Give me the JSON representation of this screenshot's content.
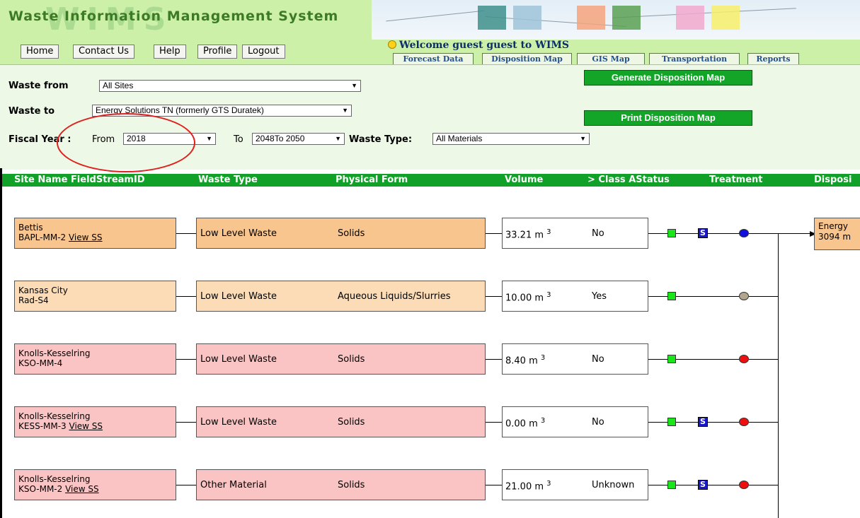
{
  "header": {
    "title": "Waste Information Management System",
    "watermark": "WIMS",
    "welcome": "Welcome guest guest to WIMS"
  },
  "nav": [
    "Home",
    "Contact Us",
    "Help",
    "Profile",
    "Logout"
  ],
  "tabs": [
    "Forecast Data",
    "Disposition Map",
    "GIS Map",
    "Transportation",
    "Reports"
  ],
  "filters": {
    "waste_from_label": "Waste from",
    "waste_from_value": "All Sites",
    "waste_to_label": "Waste to",
    "waste_to_value": "Energy Solutions TN (formerly GTS Duratek)",
    "fiscal_year_label": "Fiscal Year :",
    "from_label": "From",
    "from_value": "2018",
    "to_label": "To",
    "to_value": "2048To 2050",
    "waste_type_label": "Waste Type:",
    "waste_type_value": "All Materials",
    "generate_button": "Generate Disposition Map",
    "print_button": "Print Disposition Map"
  },
  "table": {
    "headers": [
      "Site Name FieldStreamID",
      "Waste Type",
      "Physical Form",
      "Volume",
      "> Class AStatus",
      "Treatment",
      "Disposi"
    ],
    "rows": [
      {
        "site": "Bettis",
        "stream": "BAPL-MM-2",
        "link": "View SS",
        "waste_type": "Low Level Waste",
        "form": "Solids",
        "volume": "33.21 m",
        "vol_exp": "3",
        "class_a": "No",
        "has_s": true,
        "dot_color": "#1010e0",
        "site_color": "#f8c58e"
      },
      {
        "site": "Kansas City",
        "stream": "Rad-S4",
        "link": "",
        "waste_type": "Low Level Waste",
        "form": "Aqueous Liquids/Slurries",
        "volume": "10.00 m",
        "vol_exp": "3",
        "class_a": "Yes",
        "has_s": false,
        "dot_color": "#b3a58e",
        "site_color": "#fbdcb6"
      },
      {
        "site": "Knolls-Kesselring",
        "stream": "KSO-MM-4",
        "link": "",
        "waste_type": "Low Level Waste",
        "form": "Solids",
        "volume": "8.40 m",
        "vol_exp": "3",
        "class_a": "No",
        "has_s": false,
        "dot_color": "#ee1010",
        "site_color": "#fbc4c4"
      },
      {
        "site": "Knolls-Kesselring",
        "stream": "KESS-MM-3",
        "link": "View SS",
        "waste_type": "Low Level Waste",
        "form": "Solids",
        "volume": "0.00 m",
        "vol_exp": "3",
        "class_a": "No",
        "has_s": true,
        "dot_color": "#ee1010",
        "site_color": "#fbc4c4"
      },
      {
        "site": "Knolls-Kesselring",
        "stream": "KSO-MM-2",
        "link": "View SS",
        "waste_type": "Other Material",
        "form": "Solids",
        "volume": "21.00 m",
        "vol_exp": "3",
        "class_a": "Unknown",
        "has_s": true,
        "dot_color": "#ee1010",
        "site_color": "#fbc4c4"
      }
    ]
  },
  "destination": {
    "line1": "Energy",
    "line2": "3094 m"
  },
  "s_label": "S"
}
